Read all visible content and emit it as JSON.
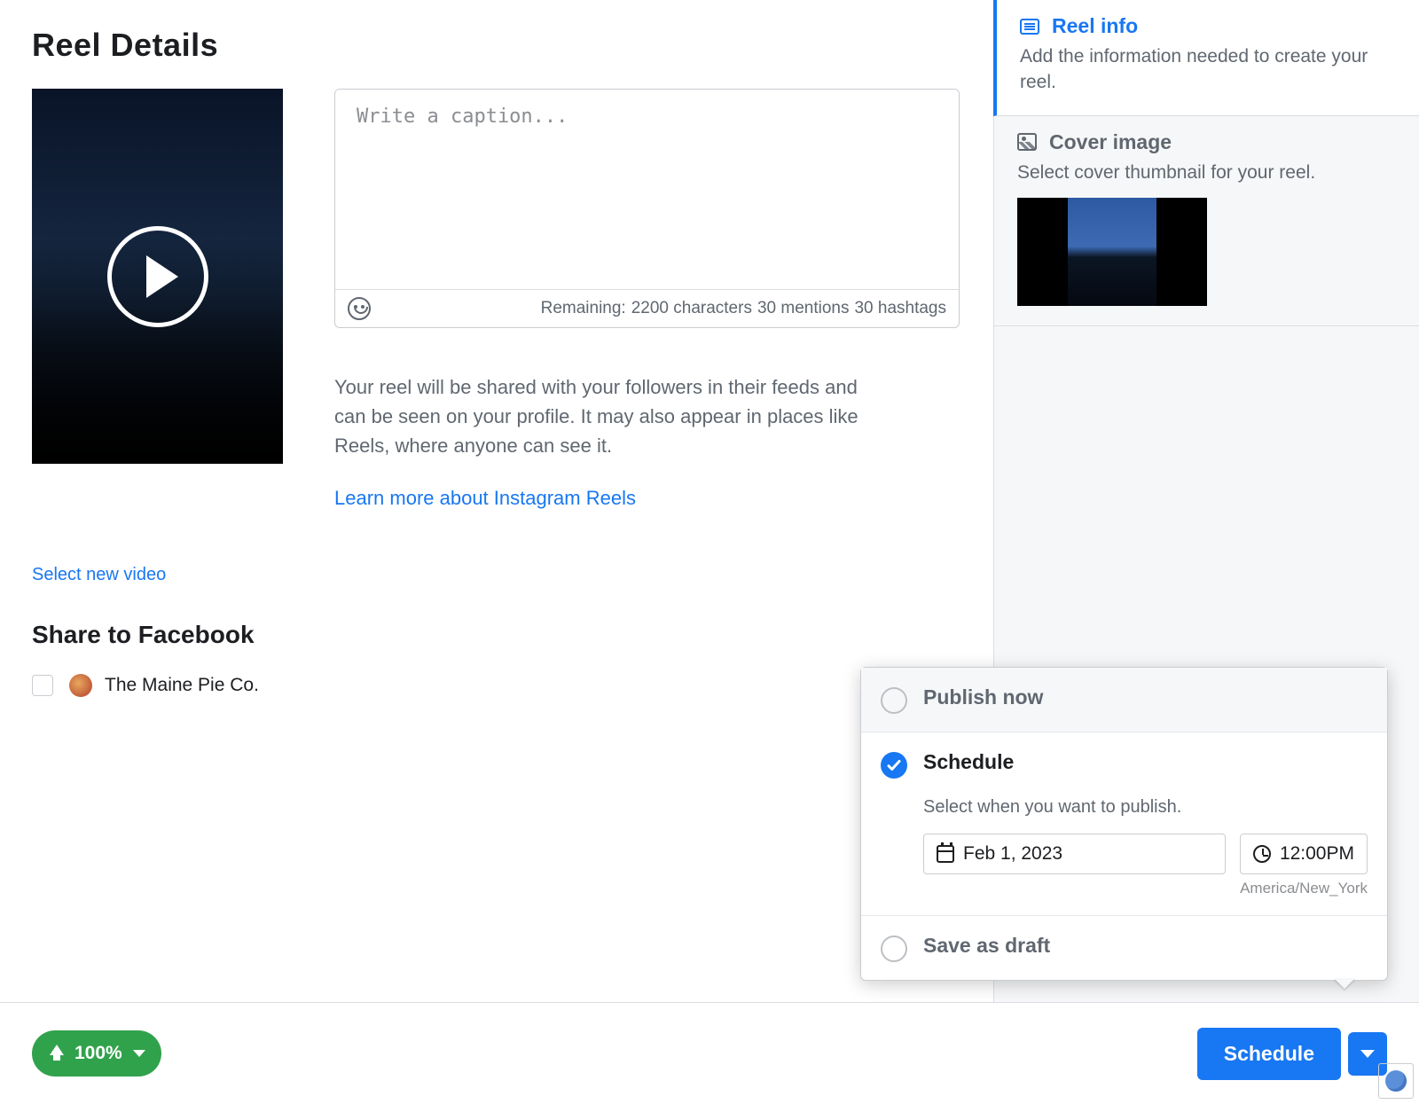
{
  "page": {
    "title": "Reel Details",
    "select_new_video": "Select new video",
    "share_heading": "Share to Facebook",
    "share_pages": [
      {
        "name": "The Maine Pie Co."
      }
    ]
  },
  "caption": {
    "placeholder": "Write a caption...",
    "remaining_label": "Remaining:",
    "chars": "2200 characters",
    "mentions": "30 mentions",
    "hashtags": "30 hashtags"
  },
  "info": {
    "body": "Your reel will be shared with your followers in their feeds and can be seen on your profile. It may also appear in places like Reels, where anyone can see it.",
    "learn_more": "Learn more about Instagram Reels"
  },
  "side": {
    "reel_info": {
      "title": "Reel info",
      "desc": "Add the information needed to create your reel."
    },
    "cover": {
      "title": "Cover image",
      "desc": "Select cover thumbnail for your reel."
    }
  },
  "popover": {
    "publish_now": "Publish now",
    "schedule": "Schedule",
    "schedule_desc": "Select when you want to publish.",
    "date": "Feb 1, 2023",
    "time": "12:00PM",
    "timezone": "America/New_York",
    "save_draft": "Save as draft"
  },
  "footer": {
    "upload_pct": "100%",
    "schedule_btn": "Schedule"
  }
}
